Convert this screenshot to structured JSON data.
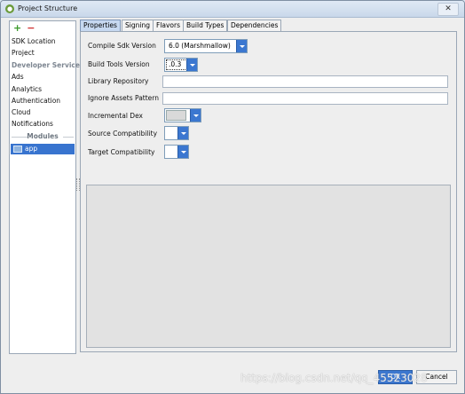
{
  "window": {
    "title": "Project Structure",
    "close_glyph": "✕"
  },
  "sidebar": {
    "add_glyph": "+",
    "remove_glyph": "−",
    "items": [
      {
        "label": "SDK Location"
      },
      {
        "label": "Project"
      },
      {
        "label": "Developer Services"
      },
      {
        "label": "Ads"
      },
      {
        "label": "Analytics"
      },
      {
        "label": "Authentication"
      },
      {
        "label": "Cloud"
      },
      {
        "label": "Notifications"
      }
    ],
    "modules_header": "Modules",
    "module_app": "app"
  },
  "tabs": [
    "Properties",
    "Signing",
    "Flavors",
    "Build Types",
    "Dependencies"
  ],
  "form": {
    "compile_sdk_label": "Compile Sdk Version",
    "compile_sdk_value": "6.0 (Marshmallow)",
    "build_tools_label": "Build Tools Version",
    "build_tools_value": ".0.3",
    "library_repo_label": "Library Repository",
    "library_repo_value": "",
    "ignore_assets_label": "Ignore Assets Pattern",
    "ignore_assets_value": "",
    "incremental_dex_label": "Incremental Dex",
    "source_compat_label": "Source Compatibility",
    "target_compat_label": "Target Compatibility"
  },
  "buttons": {
    "ok": "OK",
    "cancel": "Cancel"
  },
  "watermark": "https://blog.csdn.net/qq_45523028",
  "colors": {
    "accent": "#3b77d0",
    "selection": "#3874cf"
  }
}
